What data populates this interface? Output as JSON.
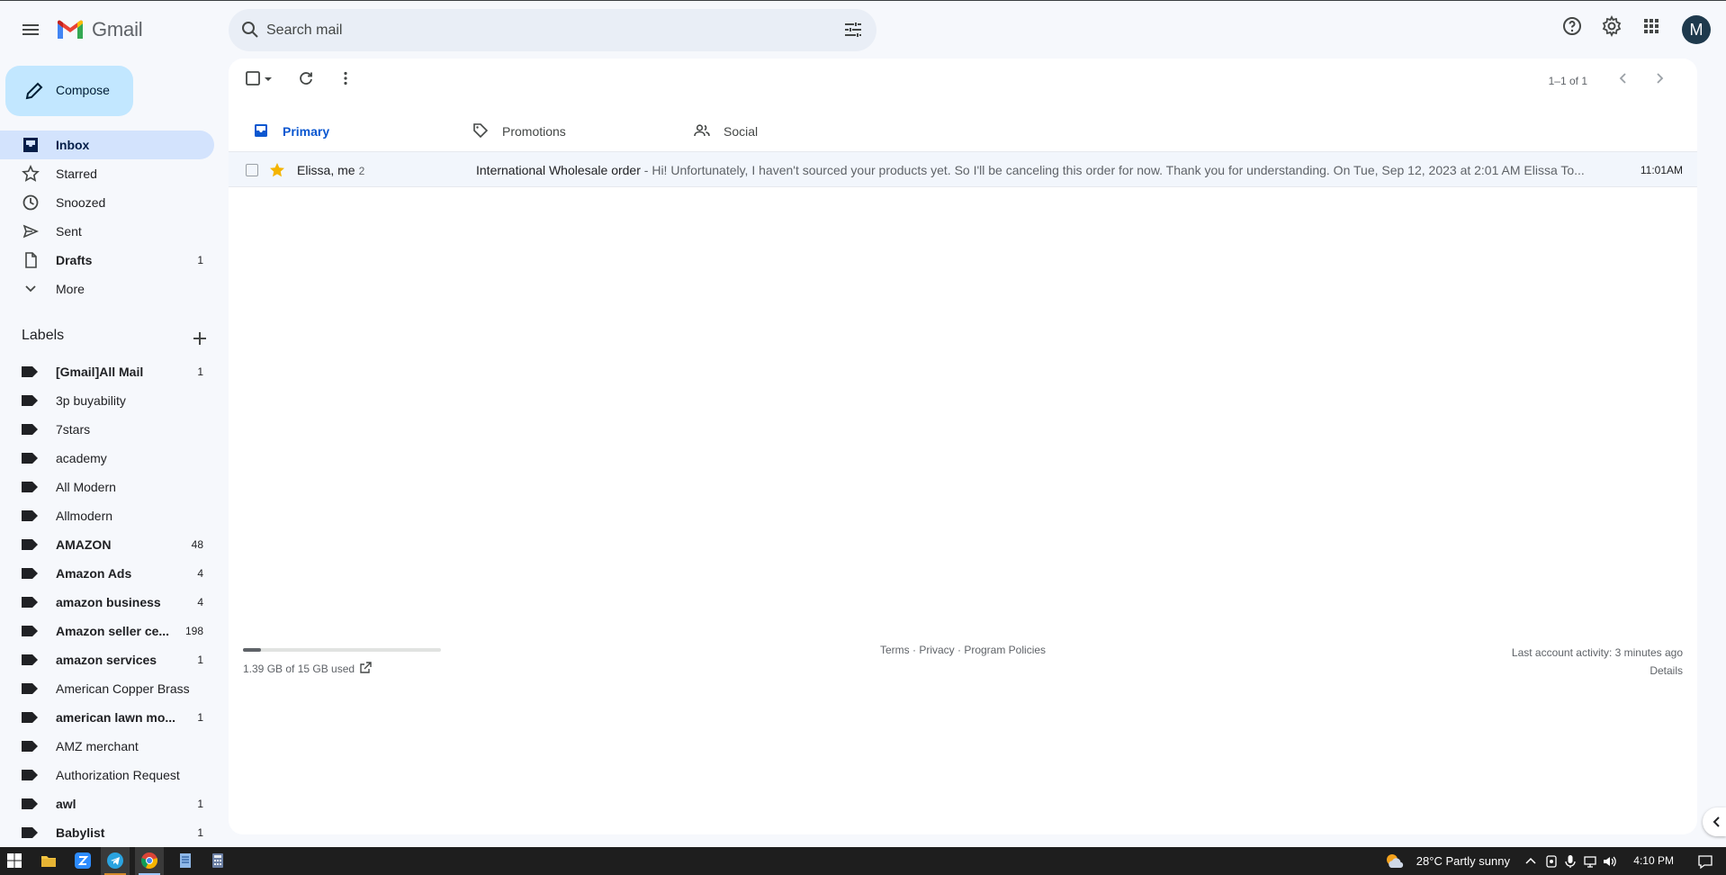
{
  "app": {
    "name": "Gmail"
  },
  "search": {
    "placeholder": "Search mail"
  },
  "account": {
    "initial": "M"
  },
  "compose": {
    "label": "Compose"
  },
  "nav": [
    {
      "label": "Inbox",
      "count": "",
      "icon": "inbox-icon",
      "active": true
    },
    {
      "label": "Starred",
      "count": "",
      "icon": "star-icon"
    },
    {
      "label": "Snoozed",
      "count": "",
      "icon": "clock-icon"
    },
    {
      "label": "Sent",
      "count": "",
      "icon": "send-icon"
    },
    {
      "label": "Drafts",
      "count": "1",
      "icon": "draft-icon",
      "bold": true
    },
    {
      "label": "More",
      "count": "",
      "icon": "chevron-down-icon"
    }
  ],
  "labels_title": "Labels",
  "labels": [
    {
      "label": "[Gmail]All Mail",
      "count": "1",
      "bold": true
    },
    {
      "label": "3p buyability",
      "count": ""
    },
    {
      "label": "7stars",
      "count": ""
    },
    {
      "label": "academy",
      "count": ""
    },
    {
      "label": "All Modern",
      "count": ""
    },
    {
      "label": "Allmodern",
      "count": ""
    },
    {
      "label": "AMAZON",
      "count": "48",
      "bold": true
    },
    {
      "label": "Amazon Ads",
      "count": "4",
      "bold": true
    },
    {
      "label": "amazon business",
      "count": "4",
      "bold": true
    },
    {
      "label": "Amazon seller ce...",
      "count": "198",
      "bold": true
    },
    {
      "label": "amazon services",
      "count": "1",
      "bold": true
    },
    {
      "label": "American Copper Brass",
      "count": ""
    },
    {
      "label": "american lawn mo...",
      "count": "1",
      "bold": true
    },
    {
      "label": "AMZ merchant",
      "count": ""
    },
    {
      "label": "Authorization Request",
      "count": ""
    },
    {
      "label": "awl",
      "count": "1",
      "bold": true
    },
    {
      "label": "Babylist",
      "count": "1",
      "bold": true
    }
  ],
  "toolbar": {
    "pagination": "1–1 of 1"
  },
  "tabs": [
    {
      "label": "Primary",
      "icon": "inbox-icon",
      "active": true
    },
    {
      "label": "Promotions",
      "icon": "tag-icon"
    },
    {
      "label": "Social",
      "icon": "people-icon"
    }
  ],
  "emails": [
    {
      "sender": "Elissa, me",
      "thread_count": "2",
      "subject": "International Wholesale order",
      "preview": " - Hi! Unfortunately, I haven't sourced your products yet. So I'll be canceling this order for now. Thank you for understanding. On Tue, Sep 12, 2023 at 2:01 AM Elissa To...",
      "time": "11:01AM",
      "starred": true
    }
  ],
  "storage": {
    "text": "1.39 GB of 15 GB used",
    "fraction": 0.093
  },
  "footer": {
    "links": "Terms · Privacy · Program Policies",
    "activity": "Last account activity: 3 minutes ago",
    "details": "Details"
  },
  "taskbar": {
    "weather": "28°C  Partly sunny",
    "time": "4:10 PM"
  },
  "colors": {
    "accent": "#0b57d0",
    "compose_bg": "#c2e7ff",
    "active_nav": "#d3e3fd",
    "star": "#f4b400"
  }
}
